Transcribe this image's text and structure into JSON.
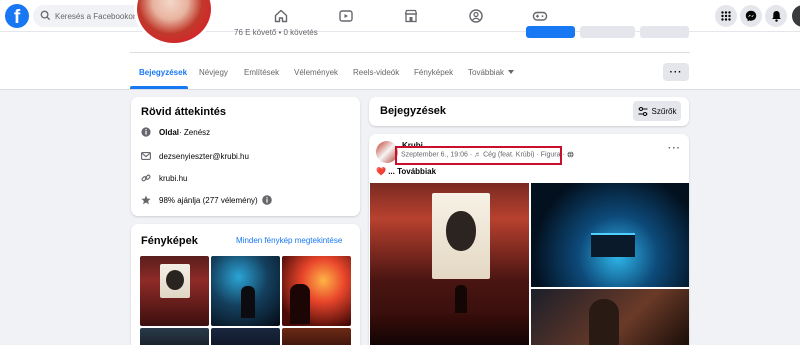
{
  "topbar": {
    "logo": "f",
    "search_placeholder": "Keresés a Facebookon",
    "nav_icons": [
      "home-icon",
      "video-icon",
      "marketplace-icon",
      "groups-icon",
      "gaming-icon"
    ],
    "right_icons": [
      "menu-grid-icon",
      "messenger-icon",
      "notifications-bell-icon"
    ]
  },
  "profile": {
    "followers": "76 E követő • 0 követés"
  },
  "tabs": [
    {
      "label": "Bejegyzések",
      "active": true
    },
    {
      "label": "Névjegy"
    },
    {
      "label": "Említések"
    },
    {
      "label": "Vélemények"
    },
    {
      "label": "Reels-videók"
    },
    {
      "label": "Fényképek"
    },
    {
      "label": "Továbbiak"
    }
  ],
  "intro": {
    "title": "Rövid áttekintés",
    "page_type_bold": "Oldal",
    "page_type_rest": " · Zenész",
    "email": "dezsenyieszter@krubi.hu",
    "website": "krubi.hu",
    "rating": "98% ajánlja (277 vélemény)"
  },
  "photos": {
    "title": "Fényképek",
    "see_all": "Minden fénykép megtekintése"
  },
  "posts": {
    "title": "Bejegyzések",
    "filter_label": "Szűrők"
  },
  "post": {
    "author": "Krubi",
    "meta": "Szeptember 6., 19:06 · ♬ Cég (feat. Krúbi) · Figura · ",
    "text": "... Továbbiak",
    "more": "···"
  },
  "colors": {
    "brand_blue": "#1877f2",
    "highlight_red": "#c8102e",
    "background": "#f0f2f5"
  }
}
